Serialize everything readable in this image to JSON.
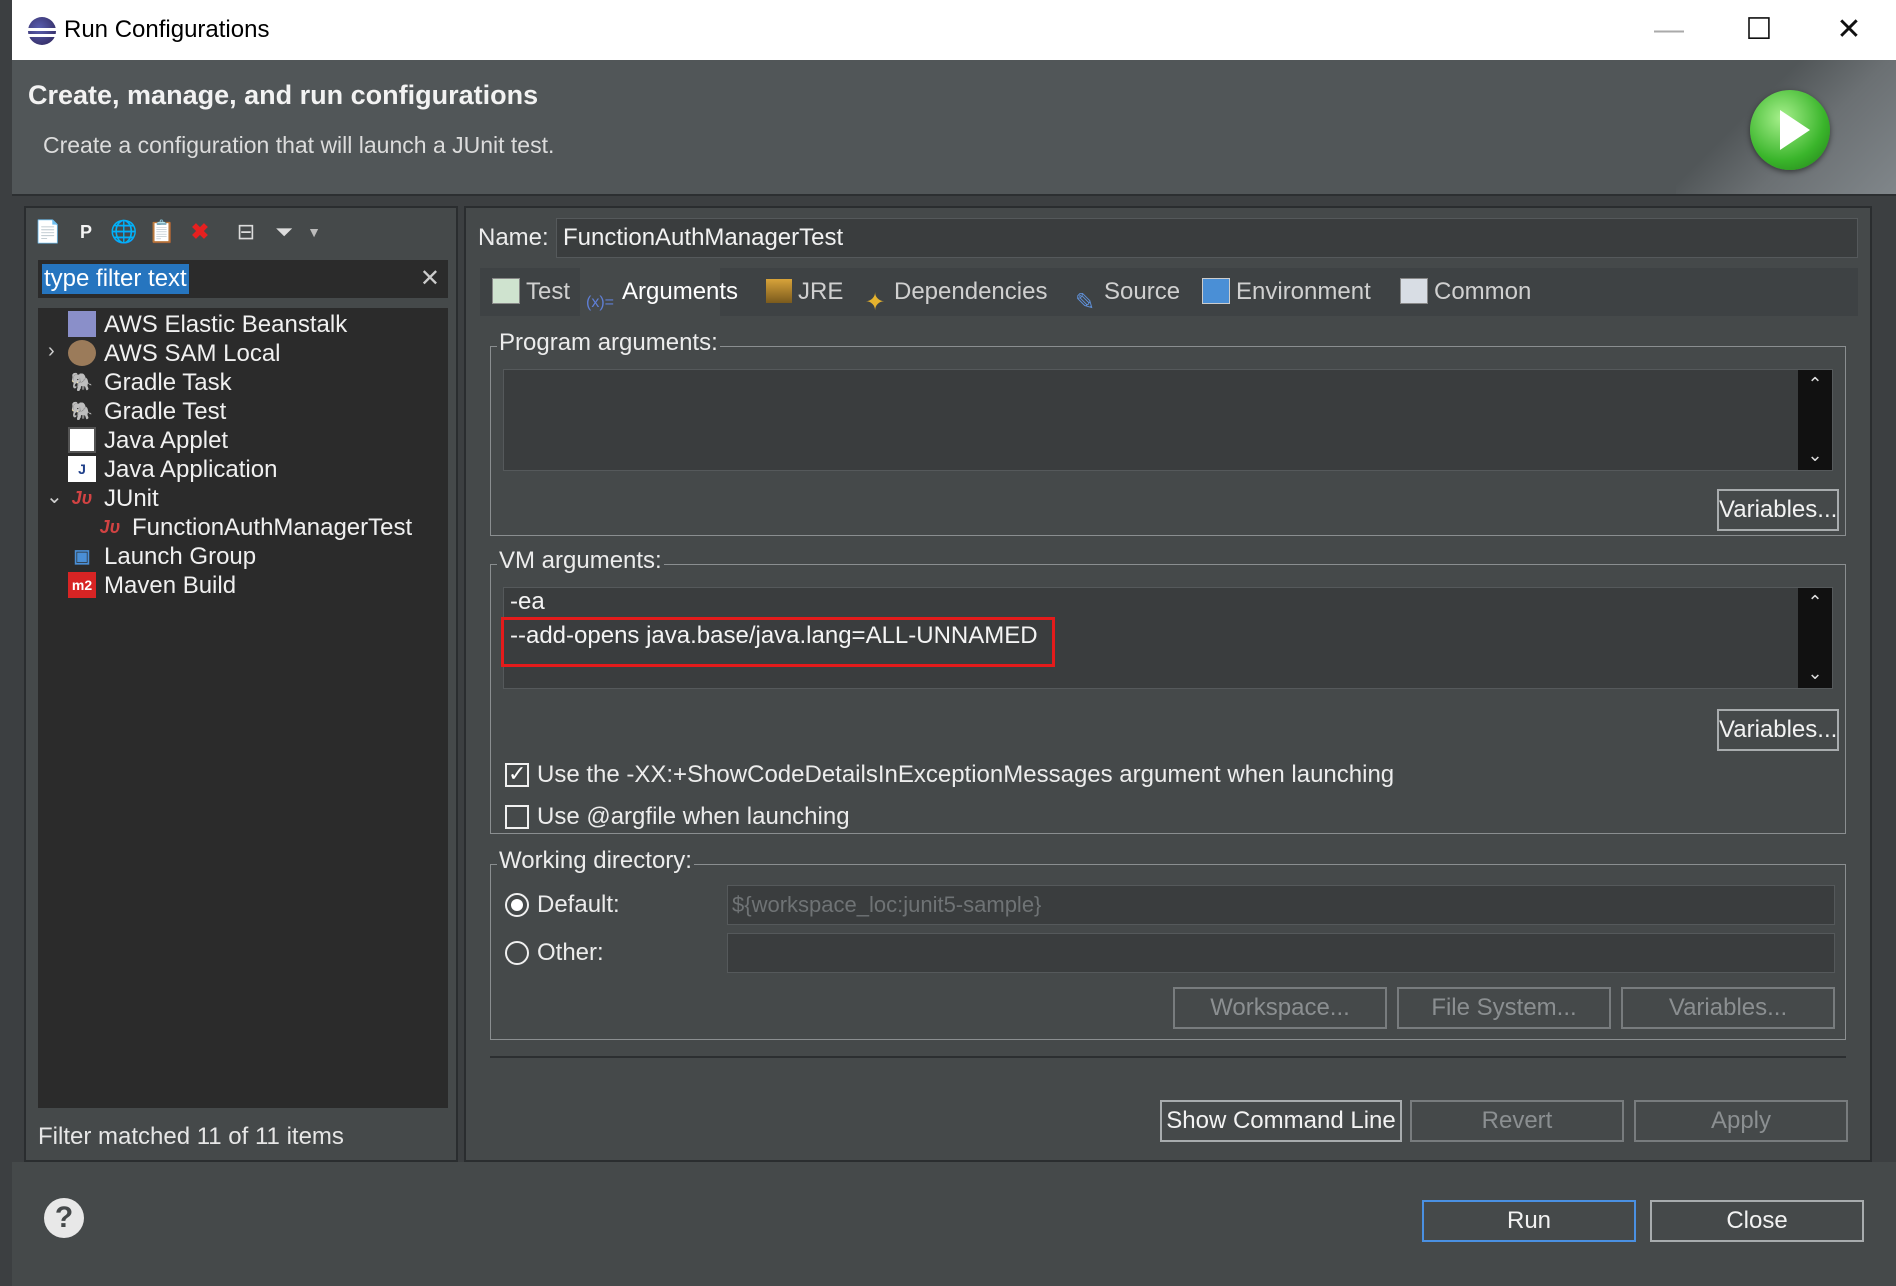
{
  "window": {
    "title": "Run Configurations",
    "minimize": "—",
    "maximize": "☐",
    "close": "✕"
  },
  "header": {
    "title": "Create, manage, and run configurations",
    "subtitle": "Create a configuration that will launch a JUnit test."
  },
  "sidebar": {
    "filter_value": "type filter text",
    "items": [
      {
        "label": "AWS Elastic Beanstalk"
      },
      {
        "label": "AWS SAM Local"
      },
      {
        "label": "Gradle Task"
      },
      {
        "label": "Gradle Test"
      },
      {
        "label": "Java Applet"
      },
      {
        "label": "Java Application"
      },
      {
        "label": "JUnit"
      },
      {
        "label": "FunctionAuthManagerTest"
      },
      {
        "label": "Launch Group"
      },
      {
        "label": "Maven Build"
      }
    ],
    "status": "Filter matched 11 of 11 items"
  },
  "config": {
    "name_label": "Name:",
    "name_value": "FunctionAuthManagerTest",
    "tabs": [
      {
        "label": "Test"
      },
      {
        "label": "Arguments"
      },
      {
        "label": "JRE"
      },
      {
        "label": "Dependencies"
      },
      {
        "label": "Source"
      },
      {
        "label": "Environment"
      },
      {
        "label": "Common"
      }
    ],
    "program_args": {
      "legend": "Program arguments:",
      "value": "",
      "variables_label": "Variables..."
    },
    "vm_args": {
      "legend": "VM arguments:",
      "line1": "-ea",
      "line2": "--add-opens java.base/java.lang=ALL-UNNAMED",
      "variables_label": "Variables..."
    },
    "options": {
      "show_code_details_label": "Use the -XX:+ShowCodeDetailsInExceptionMessages argument when launching",
      "show_code_details_checked": true,
      "argfile_label": "Use @argfile when launching",
      "argfile_checked": false
    },
    "working_dir": {
      "legend": "Working directory:",
      "default_label": "Default:",
      "default_value": "${workspace_loc:junit5-sample}",
      "other_label": "Other:",
      "other_value": "",
      "workspace_btn": "Workspace...",
      "filesystem_btn": "File System...",
      "variables_btn": "Variables..."
    },
    "show_command_line": "Show Command Line",
    "revert": "Revert",
    "apply": "Apply"
  },
  "footer": {
    "help": "?",
    "run": "Run",
    "close": "Close"
  },
  "colors": {
    "highlight": "#e41b1b",
    "background": "#45494a",
    "selection": "#2675bf"
  }
}
